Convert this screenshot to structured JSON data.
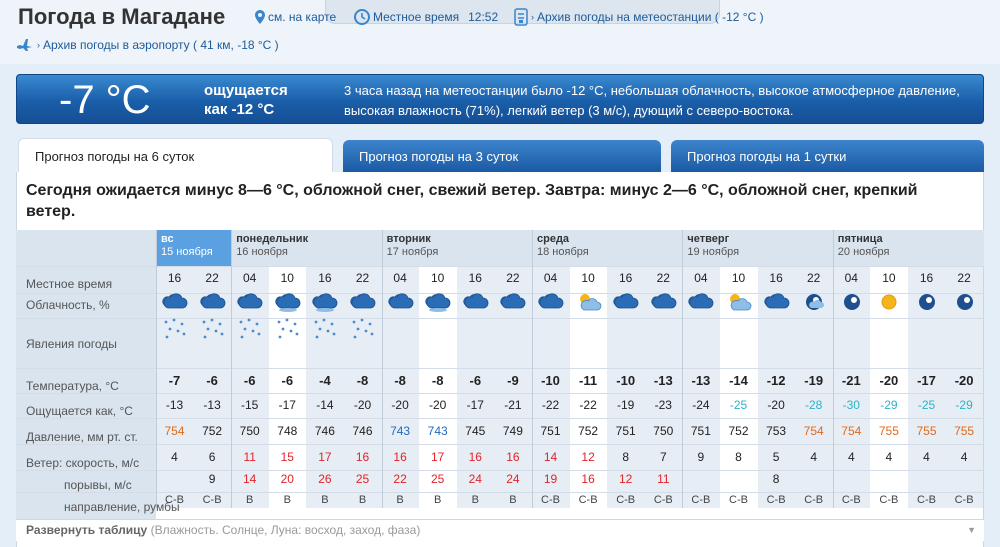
{
  "header": {
    "title": "Погода в Магадане",
    "map_link": "см. на карте",
    "local_time_label": "Местное время",
    "local_time": "12:52",
    "archive_station": "Архив погоды на метеостанции ( -12 °С )",
    "archive_airport": "Архив погоды в аэропорту ( 41 км, -18 °С )"
  },
  "now": {
    "temp": "-7 °С",
    "feels_line1": "ощущается",
    "feels_line2": "как -12 °С",
    "obs_text": "3 часа назад на метеостанции было -12 °С, небольшая облачность, высокое атмосферное давление, высокая влажность (71%), легкий ветер (3 м/с), дующий с северо-востока."
  },
  "tabs": [
    "Прогноз погоды на 6 суток",
    "Прогноз погоды на 3 суток",
    "Прогноз погоды на 1 сутки"
  ],
  "summary": "Сегодня ожидается минус 8—6 °С, обложной снег, свежий ветер. Завтра: минус 2—6 °С, обложной снег, крепкий ветер.",
  "row_labels": {
    "local_time": "Местное время",
    "cloud": "Облачность, %",
    "phenomena": "Явления погоды",
    "temp": "Температура, °С",
    "feels": "Ощущается как, °С",
    "pressure": "Давление, мм рт. ст.",
    "wind_speed": "Ветер: скорость, м/с",
    "gusts": "порывы, м/с",
    "direction": "направление, румбы"
  },
  "days": [
    {
      "name": "вс",
      "date": "15 ноября"
    },
    {
      "name": "понедельник",
      "date": "16 ноября"
    },
    {
      "name": "вторник",
      "date": "17 ноября"
    },
    {
      "name": "среда",
      "date": "18 ноября"
    },
    {
      "name": "четверг",
      "date": "19 ноября"
    },
    {
      "name": "пятница",
      "date": "20 ноября"
    }
  ],
  "columns": [
    {
      "h": "16",
      "icon": "snow-cloud-night",
      "snow": true,
      "t": "-7",
      "f": "-13",
      "p": "754",
      "pc": "hi",
      "w": "4",
      "g": "",
      "d": "С-В"
    },
    {
      "h": "22",
      "icon": "snow-cloud-night",
      "snow": true,
      "t": "-6",
      "f": "-13",
      "p": "752",
      "pc": "",
      "w": "6",
      "g": "9",
      "d": "С-В"
    },
    {
      "h": "04",
      "icon": "snow-cloud-night",
      "snow": true,
      "t": "-6",
      "f": "-15",
      "p": "750",
      "pc": "",
      "w": "11",
      "g": "14",
      "d": "В",
      "wr": true
    },
    {
      "h": "10",
      "icon": "snow-cloud-day",
      "snow": true,
      "t": "-6",
      "f": "-17",
      "p": "748",
      "pc": "",
      "w": "15",
      "g": "20",
      "d": "В",
      "wr": true
    },
    {
      "h": "16",
      "icon": "snow-cloud-day",
      "snow": true,
      "t": "-4",
      "f": "-14",
      "p": "746",
      "pc": "",
      "w": "17",
      "g": "26",
      "d": "В",
      "wr": true
    },
    {
      "h": "22",
      "icon": "snow-cloud-night",
      "snow": true,
      "t": "-8",
      "f": "-20",
      "p": "746",
      "pc": "",
      "w": "16",
      "g": "25",
      "d": "В",
      "wr": true
    },
    {
      "h": "04",
      "icon": "snow-cloud-night",
      "snow": false,
      "t": "-8",
      "f": "-20",
      "p": "743",
      "pc": "lo",
      "w": "16",
      "g": "22",
      "d": "В",
      "wr": true
    },
    {
      "h": "10",
      "icon": "snow-cloud-day",
      "snow": false,
      "t": "-8",
      "f": "-20",
      "p": "743",
      "pc": "lo",
      "w": "17",
      "g": "25",
      "d": "В",
      "wr": true
    },
    {
      "h": "16",
      "icon": "snow-cloud-night",
      "snow": false,
      "t": "-6",
      "f": "-17",
      "p": "745",
      "pc": "",
      "w": "16",
      "g": "24",
      "d": "В",
      "wr": true
    },
    {
      "h": "22",
      "icon": "snow-cloud-night",
      "snow": false,
      "t": "-9",
      "f": "-21",
      "p": "749",
      "pc": "",
      "w": "16",
      "g": "24",
      "d": "В",
      "wr": true
    },
    {
      "h": "04",
      "icon": "snow-cloud-night",
      "snow": false,
      "t": "-10",
      "f": "-22",
      "p": "751",
      "pc": "",
      "w": "14",
      "g": "19",
      "d": "С-В",
      "wr": true
    },
    {
      "h": "10",
      "icon": "partly-cloudy-day",
      "snow": false,
      "t": "-11",
      "f": "-22",
      "p": "752",
      "pc": "",
      "w": "12",
      "g": "16",
      "d": "С-В",
      "wr": true
    },
    {
      "h": "16",
      "icon": "snow-cloud-night",
      "snow": false,
      "t": "-10",
      "f": "-19",
      "p": "751",
      "pc": "",
      "w": "8",
      "g": "12",
      "d": "С-В",
      "wr": false,
      "gr": true
    },
    {
      "h": "22",
      "icon": "snow-cloud-night",
      "snow": false,
      "t": "-13",
      "f": "-23",
      "p": "750",
      "pc": "",
      "w": "7",
      "g": "11",
      "d": "С-В",
      "wr": false,
      "gr": true
    },
    {
      "h": "04",
      "icon": "snow-cloud-night",
      "snow": false,
      "t": "-13",
      "f": "-24",
      "p": "751",
      "pc": "",
      "w": "9",
      "g": "",
      "d": "С-В"
    },
    {
      "h": "10",
      "icon": "partly-cloudy-day",
      "snow": false,
      "t": "-14",
      "f": "-25",
      "fc": "cold",
      "p": "752",
      "pc": "",
      "w": "8",
      "g": "",
      "d": "С-В"
    },
    {
      "h": "16",
      "icon": "snow-cloud-night",
      "snow": false,
      "t": "-12",
      "f": "-20",
      "p": "753",
      "pc": "",
      "w": "5",
      "g": "8",
      "d": "С-В"
    },
    {
      "h": "22",
      "icon": "moon-cloud",
      "snow": false,
      "t": "-19",
      "f": "-28",
      "fc": "cold",
      "p": "754",
      "pc": "hi",
      "w": "4",
      "g": "",
      "d": "С-В"
    },
    {
      "h": "04",
      "icon": "moon-clear",
      "snow": false,
      "t": "-21",
      "f": "-30",
      "fc": "cold",
      "p": "754",
      "pc": "hi",
      "w": "4",
      "g": "",
      "d": "С-В"
    },
    {
      "h": "10",
      "icon": "sun",
      "snow": false,
      "t": "-20",
      "f": "-29",
      "fc": "cold",
      "p": "755",
      "pc": "hi",
      "w": "4",
      "g": "",
      "d": "С-В"
    },
    {
      "h": "16",
      "icon": "moon-clear",
      "snow": false,
      "t": "-17",
      "f": "-25",
      "fc": "cold",
      "p": "755",
      "pc": "hi",
      "w": "4",
      "g": "",
      "d": "С-В"
    },
    {
      "h": "22",
      "icon": "moon-clear",
      "snow": false,
      "t": "-20",
      "f": "-29",
      "fc": "cold",
      "p": "755",
      "pc": "hi",
      "w": "4",
      "g": "",
      "d": "С-В"
    }
  ],
  "footer": {
    "expand": "Развернуть таблицу",
    "expand_hint": "(Влажность. Солнце, Луна: восход, заход, фаза)"
  },
  "colors": {
    "banner": "#1a5ea9",
    "pressure_high": "#e06a1b",
    "pressure_low": "#1e6bc0",
    "wind_strong": "#e0242a",
    "feels_cold": "#2fb1c6",
    "today": "#5ba0e0"
  }
}
